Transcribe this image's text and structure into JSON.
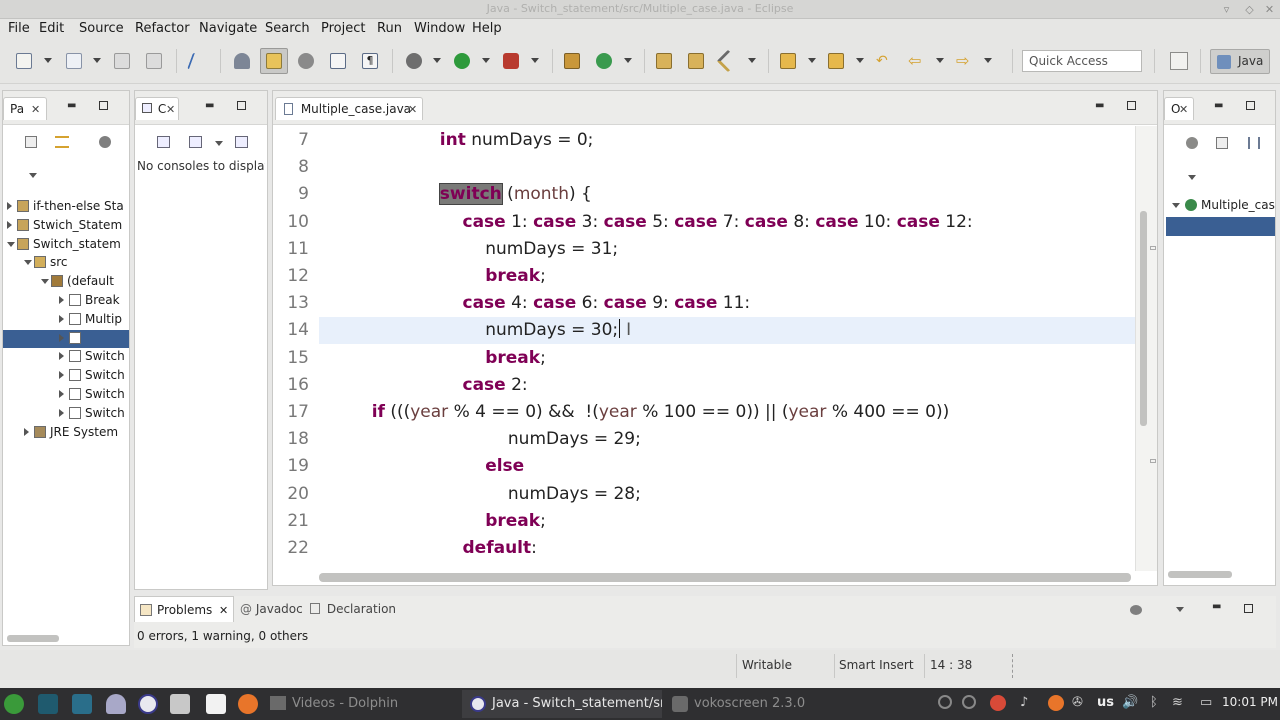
{
  "window": {
    "title": "Java - Switch_statement/src/Multiple_case.java - Eclipse"
  },
  "menu": [
    "File",
    "Edit",
    "Source",
    "Refactor",
    "Navigate",
    "Search",
    "Project",
    "Run",
    "Window",
    "Help"
  ],
  "toolbar": {
    "quick_access": "Quick Access",
    "perspective": "Java"
  },
  "package_explorer": {
    "tab": "Pa",
    "items": [
      {
        "label": "if-then-else Sta",
        "depth": 0,
        "state": "closed",
        "icon": "project-icon"
      },
      {
        "label": "Stwich_Statem",
        "depth": 0,
        "state": "closed",
        "icon": "project-icon"
      },
      {
        "label": "Switch_statem",
        "depth": 0,
        "state": "open",
        "icon": "project-icon"
      },
      {
        "label": "src",
        "depth": 1,
        "state": "open",
        "icon": "source-folder-icon"
      },
      {
        "label": "(default",
        "depth": 2,
        "state": "open",
        "icon": "package-icon"
      },
      {
        "label": "Break",
        "depth": 3,
        "state": "closed",
        "icon": "java-file-icon"
      },
      {
        "label": "Multip",
        "depth": 3,
        "state": "closed",
        "icon": "java-file-icon"
      },
      {
        "label": "",
        "depth": 3,
        "state": "closed",
        "icon": "java-file-icon",
        "selected": true
      },
      {
        "label": "Switch",
        "depth": 3,
        "state": "closed",
        "icon": "java-file-icon"
      },
      {
        "label": "Switch",
        "depth": 3,
        "state": "closed",
        "icon": "java-file-icon"
      },
      {
        "label": "Switch",
        "depth": 3,
        "state": "closed",
        "icon": "java-file-icon"
      },
      {
        "label": "Switch",
        "depth": 3,
        "state": "closed",
        "icon": "java-file-icon"
      },
      {
        "label": "JRE System",
        "depth": 1,
        "state": "closed",
        "icon": "library-icon"
      }
    ]
  },
  "console_view": {
    "tab": "C",
    "message": "No consoles to display"
  },
  "editor": {
    "tab": "Multiple_case.java",
    "current_line": 14,
    "lines": [
      {
        "n": "7",
        "indent": 4,
        "tokens": [
          [
            "kw",
            "int"
          ],
          [
            "t",
            " numDays = 0;"
          ]
        ]
      },
      {
        "n": "8",
        "indent": 0,
        "tokens": []
      },
      {
        "n": "9",
        "indent": 4,
        "tokens": [
          [
            "hl",
            "switch"
          ],
          [
            "t",
            " ("
          ],
          [
            "v",
            "month"
          ],
          [
            "t",
            ") {"
          ]
        ]
      },
      {
        "n": "10",
        "indent": 5,
        "tokens": [
          [
            "kw",
            "case"
          ],
          [
            "t",
            " 1: "
          ],
          [
            "kw",
            "case"
          ],
          [
            "t",
            " 3: "
          ],
          [
            "kw",
            "case"
          ],
          [
            "t",
            " 5: "
          ],
          [
            "kw",
            "case"
          ],
          [
            "t",
            " 7: "
          ],
          [
            "kw",
            "case"
          ],
          [
            "t",
            " 8: "
          ],
          [
            "kw",
            "case"
          ],
          [
            "t",
            " 10: "
          ],
          [
            "kw",
            "case"
          ],
          [
            "t",
            " 12:"
          ]
        ]
      },
      {
        "n": "11",
        "indent": 6,
        "tokens": [
          [
            "t",
            "numDays = 31;"
          ]
        ]
      },
      {
        "n": "12",
        "indent": 6,
        "tokens": [
          [
            "kw",
            "break"
          ],
          [
            "t",
            ";"
          ]
        ]
      },
      {
        "n": "13",
        "indent": 5,
        "tokens": [
          [
            "kw",
            "case"
          ],
          [
            "t",
            " 4: "
          ],
          [
            "kw",
            "case"
          ],
          [
            "t",
            " 6: "
          ],
          [
            "kw",
            "case"
          ],
          [
            "t",
            " 9: "
          ],
          [
            "kw",
            "case"
          ],
          [
            "t",
            " 11:"
          ]
        ]
      },
      {
        "n": "14",
        "indent": 6,
        "tokens": [
          [
            "t",
            "numDays = 30;"
          ]
        ]
      },
      {
        "n": "15",
        "indent": 6,
        "tokens": [
          [
            "kw",
            "break"
          ],
          [
            "t",
            ";"
          ]
        ]
      },
      {
        "n": "16",
        "indent": 5,
        "tokens": [
          [
            "kw",
            "case"
          ],
          [
            "t",
            " 2:"
          ]
        ]
      },
      {
        "n": "17",
        "indent": 1,
        "tokens": [
          [
            "kw",
            "if"
          ],
          [
            "t",
            " ((("
          ],
          [
            "v",
            "year"
          ],
          [
            "t",
            " % 4 == 0) &&  !("
          ],
          [
            "v",
            "year"
          ],
          [
            "t",
            " % 100 == 0)) || ("
          ],
          [
            "v",
            "year"
          ],
          [
            "t",
            " % 400 == 0))"
          ]
        ]
      },
      {
        "n": "18",
        "indent": 7,
        "tokens": [
          [
            "t",
            "numDays = 29;"
          ]
        ]
      },
      {
        "n": "19",
        "indent": 6,
        "tokens": [
          [
            "kw",
            "else"
          ]
        ]
      },
      {
        "n": "20",
        "indent": 7,
        "tokens": [
          [
            "t",
            "numDays = 28;"
          ]
        ]
      },
      {
        "n": "21",
        "indent": 6,
        "tokens": [
          [
            "kw",
            "break"
          ],
          [
            "t",
            ";"
          ]
        ]
      },
      {
        "n": "22",
        "indent": 5,
        "tokens": [
          [
            "kw",
            "default"
          ],
          [
            "t",
            ":"
          ]
        ]
      }
    ]
  },
  "outline": {
    "tab": "O",
    "item": "Multiple_cas"
  },
  "problems_view": {
    "tabs": [
      "Problems",
      "Javadoc",
      "Declaration"
    ],
    "summary": "0 errors, 1 warning, 0 others"
  },
  "status": {
    "writable": "Writable",
    "insert_mode": "Smart Insert",
    "position": "14 : 38"
  },
  "taskbar": {
    "windows": [
      {
        "label": "Videos - Dolphin",
        "active": false
      },
      {
        "label": "Java - Switch_statement/src/",
        "active": true
      },
      {
        "label": "vokoscreen 2.3.0",
        "active": false
      }
    ],
    "keyboard": "us",
    "clock": "10:01 PM"
  },
  "colors": {
    "keyword": "#7f0055",
    "variable": "#6a3e3e",
    "current_line": "#e8f0fb",
    "selection": "#3a5f93"
  }
}
